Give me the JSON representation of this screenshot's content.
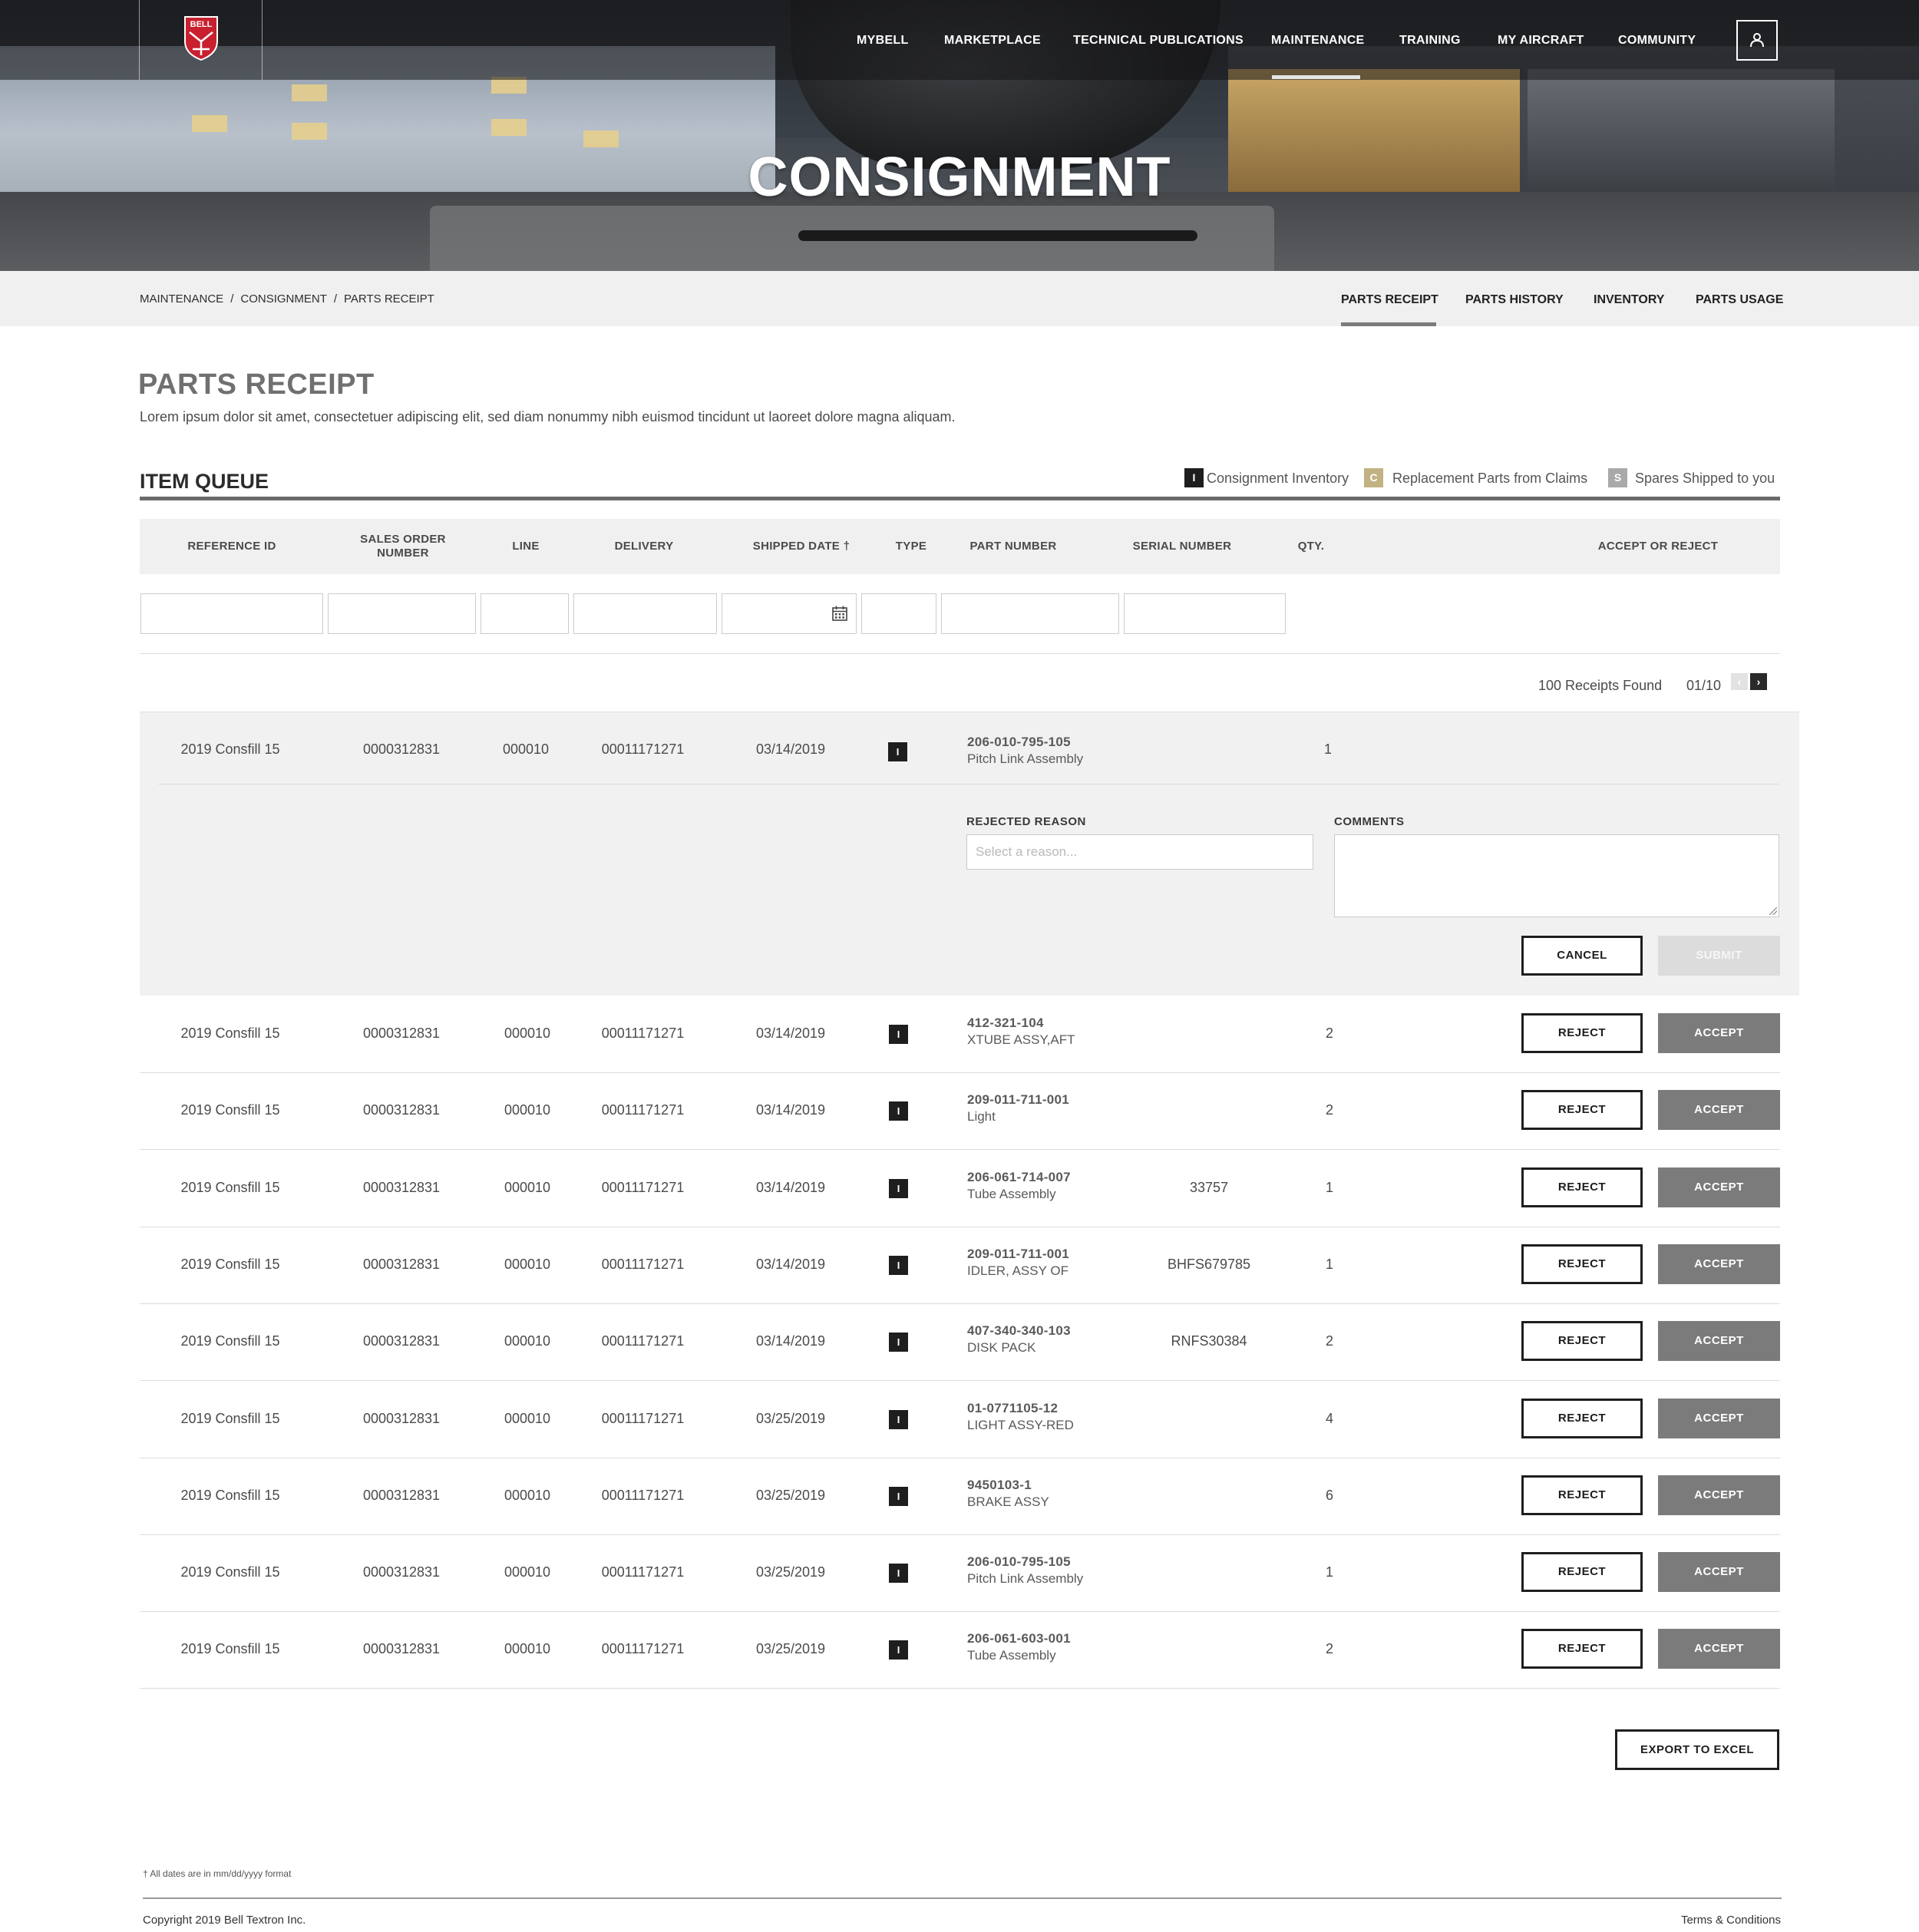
{
  "brand": {
    "logo_text": "BELL"
  },
  "nav": {
    "items": [
      {
        "label": "MYBELL"
      },
      {
        "label": "MARKETPLACE"
      },
      {
        "label": "TECHNICAL PUBLICATIONS"
      },
      {
        "label": "MAINTENANCE",
        "active": true
      },
      {
        "label": "TRAINING"
      },
      {
        "label": "MY AIRCRAFT"
      },
      {
        "label": "COMMUNITY"
      }
    ],
    "user_icon": "user-icon"
  },
  "hero": {
    "title": "CONSIGNMENT"
  },
  "breadcrumb": [
    {
      "label": "MAINTENANCE"
    },
    {
      "label": "CONSIGNMENT"
    },
    {
      "label": "PARTS RECEIPT"
    }
  ],
  "breadcrumb_sep": "/",
  "subtabs": [
    {
      "label": "PARTS RECEIPT",
      "active": true
    },
    {
      "label": "PARTS HISTORY"
    },
    {
      "label": "INVENTORY"
    },
    {
      "label": "PARTS USAGE"
    }
  ],
  "page": {
    "title": "PARTS RECEIPT",
    "description": "Lorem ipsum dolor sit amet, consectetuer adipiscing elit, sed diam nonummy nibh euismod tincidunt ut laoreet dolore magna aliquam."
  },
  "queue": {
    "title": "ITEM QUEUE",
    "legend": [
      {
        "code": "I",
        "label": "Consignment Inventory",
        "color": "#1e1e1e"
      },
      {
        "code": "C",
        "label": "Replacement Parts from Claims",
        "color": "#c2b283"
      },
      {
        "code": "S",
        "label": "Spares Shipped to you",
        "color": "#a9a9a9"
      }
    ]
  },
  "table": {
    "columns": {
      "reference_id": "REFERENCE ID",
      "sales_order_1": "SALES ORDER",
      "sales_order_2": "NUMBER",
      "line": "LINE",
      "delivery": "DELIVERY",
      "shipped_date": "SHIPPED DATE †",
      "type": "TYPE",
      "part_number": "PART NUMBER",
      "serial_number": "SERIAL NUMBER",
      "qty": "QTY.",
      "accept_reject": "ACCEPT OR REJECT"
    },
    "receipts_found": "100 Receipts Found",
    "page_indicator": "01/10",
    "prev_icon": "‹",
    "next_icon": "›",
    "expanded_row": {
      "reference_id": "2019 Consfill 15",
      "sales_order": "0000312831",
      "line": "000010",
      "delivery": "00011171271",
      "shipped_date": "03/14/2019",
      "type": "I",
      "part_number": "206-010-795-105",
      "part_desc": "Pitch Link Assembly",
      "serial_number": "",
      "qty": "1",
      "rejected_reason_label": "REJECTED REASON",
      "rejected_reason_placeholder": "Select a reason...",
      "comments_label": "COMMENTS",
      "cancel_label": "CANCEL",
      "submit_label": "SUBMIT"
    },
    "rows": [
      {
        "reference_id": "2019 Consfill 15",
        "sales_order": "0000312831",
        "line": "000010",
        "delivery": "00011171271",
        "shipped_date": "03/14/2019",
        "type": "I",
        "part_number": "412-321-104",
        "part_desc": "XTUBE ASSY,AFT",
        "serial_number": "",
        "qty": "2"
      },
      {
        "reference_id": "2019 Consfill 15",
        "sales_order": "0000312831",
        "line": "000010",
        "delivery": "00011171271",
        "shipped_date": "03/14/2019",
        "type": "I",
        "part_number": "209-011-711-001",
        "part_desc": "Light",
        "serial_number": "",
        "qty": "2"
      },
      {
        "reference_id": "2019 Consfill 15",
        "sales_order": "0000312831",
        "line": "000010",
        "delivery": "00011171271",
        "shipped_date": "03/14/2019",
        "type": "I",
        "part_number": "206-061-714-007",
        "part_desc": "Tube Assembly",
        "serial_number": "33757",
        "qty": "1"
      },
      {
        "reference_id": "2019 Consfill 15",
        "sales_order": "0000312831",
        "line": "000010",
        "delivery": "00011171271",
        "shipped_date": "03/14/2019",
        "type": "I",
        "part_number": "209-011-711-001",
        "part_desc": "IDLER, ASSY OF",
        "serial_number": "BHFS679785",
        "qty": "1"
      },
      {
        "reference_id": "2019 Consfill 15",
        "sales_order": "0000312831",
        "line": "000010",
        "delivery": "00011171271",
        "shipped_date": "03/14/2019",
        "type": "I",
        "part_number": "407-340-340-103",
        "part_desc": "DISK PACK",
        "serial_number": "RNFS30384",
        "qty": "2"
      },
      {
        "reference_id": "2019 Consfill 15",
        "sales_order": "0000312831",
        "line": "000010",
        "delivery": "00011171271",
        "shipped_date": "03/25/2019",
        "type": "I",
        "part_number": "01-0771105-12",
        "part_desc": "LIGHT ASSY-RED",
        "serial_number": "",
        "qty": "4"
      },
      {
        "reference_id": "2019 Consfill 15",
        "sales_order": "0000312831",
        "line": "000010",
        "delivery": "00011171271",
        "shipped_date": "03/25/2019",
        "type": "I",
        "part_number": "9450103-1",
        "part_desc": "BRAKE ASSY",
        "serial_number": "",
        "qty": "6"
      },
      {
        "reference_id": "2019 Consfill 15",
        "sales_order": "0000312831",
        "line": "000010",
        "delivery": "00011171271",
        "shipped_date": "03/25/2019",
        "type": "I",
        "part_number": "206-010-795-105",
        "part_desc": "Pitch Link Assembly",
        "serial_number": "",
        "qty": "1"
      },
      {
        "reference_id": "2019 Consfill 15",
        "sales_order": "0000312831",
        "line": "000010",
        "delivery": "00011171271",
        "shipped_date": "03/25/2019",
        "type": "I",
        "part_number": "206-061-603-001",
        "part_desc": "Tube Assembly",
        "serial_number": "",
        "qty": "2"
      }
    ],
    "reject_label": "REJECT",
    "accept_label": "ACCEPT"
  },
  "export_label": "EXPORT TO EXCEL",
  "footnote": "† All dates are in mm/dd/yyyy format",
  "footer": {
    "copyright": "Copyright 2019 Bell Textron Inc.",
    "terms": "Terms & Conditions"
  },
  "colors": {
    "accept": "#7b7b7b",
    "dark": "#1e1e1e",
    "panel": "#f0f0f0"
  }
}
